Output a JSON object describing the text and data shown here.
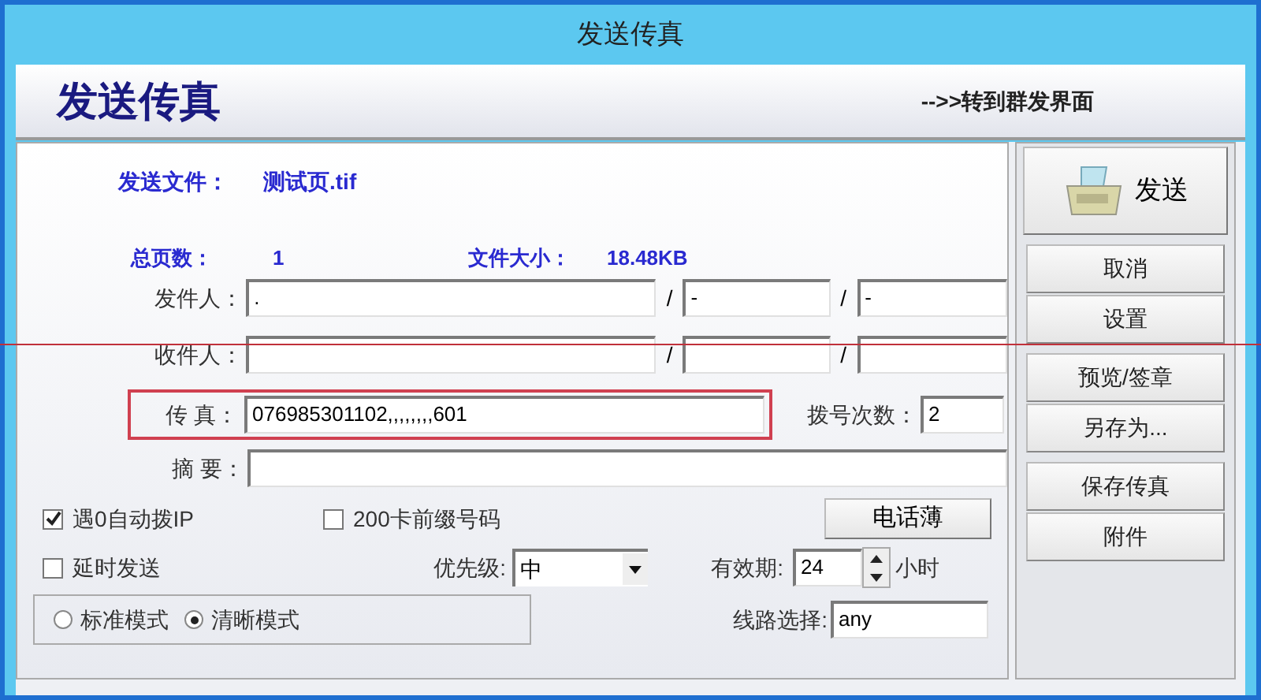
{
  "window": {
    "title": "发送传真"
  },
  "header": {
    "title": "发送传真",
    "link": "-->>转到群发界面"
  },
  "file": {
    "label": "发送文件：",
    "name": "测试页.tif"
  },
  "pages": {
    "label": "总页数：",
    "value": "1"
  },
  "size": {
    "label": "文件大小：",
    "value": "18.48KB"
  },
  "sender": {
    "label": "发件人：",
    "values": [
      ".",
      "-",
      "-"
    ],
    "separators": [
      "/",
      "/"
    ]
  },
  "recipient": {
    "label": "收件人：",
    "separators": [
      "/",
      "/"
    ]
  },
  "fax": {
    "label": "传 真：",
    "value": "076985301102,,,,,,,,601",
    "highlighted": true
  },
  "redial": {
    "label": "拨号次数：",
    "value": "2"
  },
  "summary": {
    "label": "摘 要："
  },
  "checkboxes": [
    {
      "label": "遇0自动拨IP",
      "checked": true
    },
    {
      "label": "200卡前缀号码",
      "checked": false
    },
    {
      "label": "延时发送",
      "checked": false
    }
  ],
  "phonebook_button": "电话薄",
  "priority": {
    "label": "优先级:",
    "value": "中"
  },
  "validity": {
    "label": "有效期:",
    "value": "24",
    "unit": "小时"
  },
  "modes": [
    {
      "label": "标准模式",
      "selected": false
    },
    {
      "label": "清晰模式",
      "selected": true
    }
  ],
  "line": {
    "label": "线路选择:",
    "value": "any"
  },
  "send_button": "发送",
  "side_button_groups": [
    [
      "取消",
      "设置"
    ],
    [
      "预览/签章",
      "另存为..."
    ],
    [
      "保存传真",
      "附件"
    ]
  ]
}
